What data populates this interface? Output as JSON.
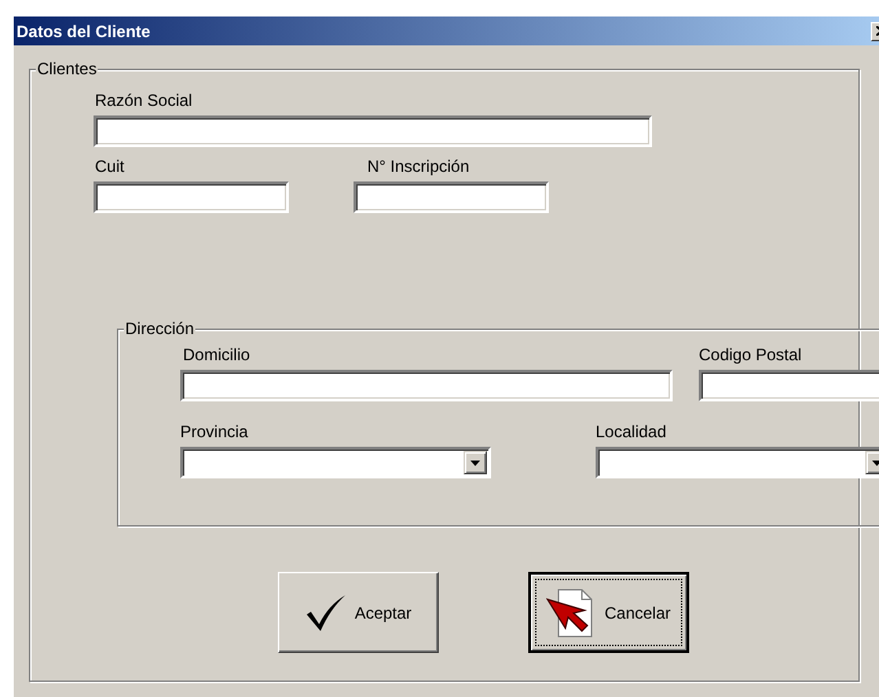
{
  "window": {
    "title": "Datos del Cliente"
  },
  "clientes": {
    "legend": "Clientes",
    "rows": [
      [
        {
          "label": "Razón Social",
          "kind": "text"
        }
      ],
      [
        {
          "label": "Cuit",
          "kind": "text"
        },
        {
          "label": "N° Inscripción",
          "kind": "text"
        }
      ]
    ]
  },
  "direccion": {
    "legend": "Dirección",
    "rows": [
      [
        {
          "label": "Domicilio",
          "kind": "text"
        },
        {
          "label": "Codigo Postal",
          "kind": "text"
        }
      ],
      [
        {
          "label": "Provincia",
          "kind": "combo"
        },
        {
          "label": "Localidad",
          "kind": "combo"
        }
      ]
    ]
  },
  "buttons": [
    {
      "label": "Aceptar",
      "kind": "check",
      "default": false
    },
    {
      "label": "Cancelar",
      "kind": "cancel",
      "default": true
    }
  ]
}
